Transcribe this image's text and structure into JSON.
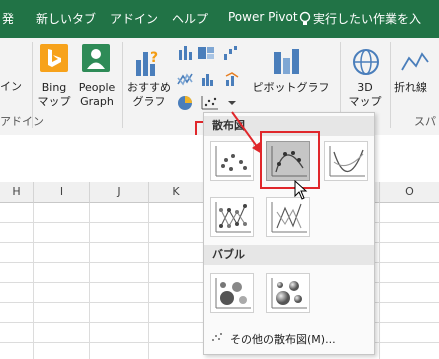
{
  "tabs": [
    "発",
    "新しいタブ",
    "アドイン",
    "ヘルプ",
    "Power Pivot"
  ],
  "tell_me": "実行したい作業を入",
  "ribbon": {
    "left_partial": "イン",
    "left_partial_group": "アドイン",
    "bing": "Bing\nマップ",
    "people": "People\nGraph",
    "recommended": "おすすめ\nグラフ",
    "pivot": "ピボットグラフ",
    "map3d": "3D\nマップ",
    "line": "折れ線",
    "right_partial": "スパ"
  },
  "columns": [
    "H",
    "I",
    "J",
    "K",
    "O"
  ],
  "dropdown": {
    "scatter_header": "散布図",
    "bubble_header": "バブル",
    "more_label": "その他の散布図(M)..."
  },
  "colors": {
    "excel_green": "#217346",
    "highlight_red": "#e0272b"
  }
}
